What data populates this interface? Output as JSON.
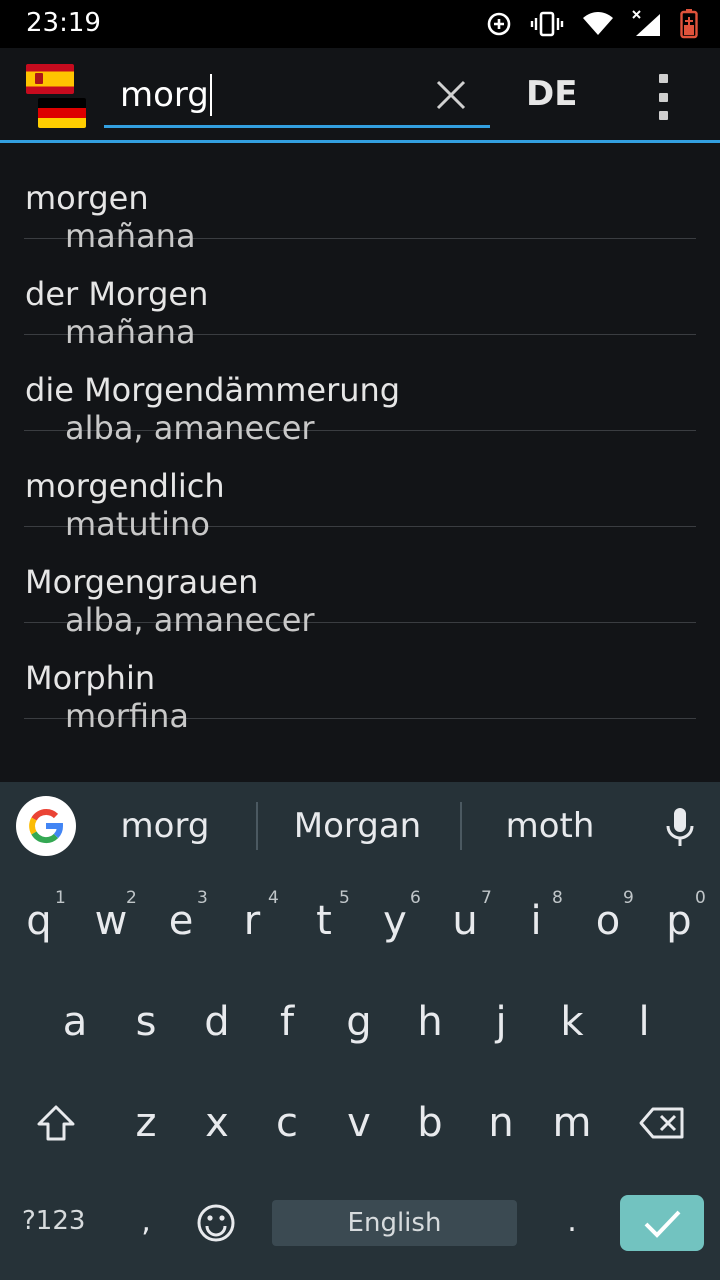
{
  "status_bar": {
    "time": "23:19"
  },
  "search": {
    "query": "morg"
  },
  "language_toggle": "DE",
  "results": [
    {
      "term": "morgen",
      "translation": "mañana"
    },
    {
      "term": "der Morgen",
      "translation": "mañana"
    },
    {
      "term": "die Morgendämmerung",
      "translation": "alba, amanecer"
    },
    {
      "term": "morgendlich",
      "translation": "matutino"
    },
    {
      "term": "Morgengrauen",
      "translation": "alba, amanecer"
    },
    {
      "term": "Morphin",
      "translation": "morfina"
    }
  ],
  "suggestions": [
    "morg",
    "Morgan",
    "moth"
  ],
  "keyboard": {
    "row1": [
      "q",
      "w",
      "e",
      "r",
      "t",
      "y",
      "u",
      "i",
      "o",
      "p"
    ],
    "row1_hints": [
      "1",
      "2",
      "3",
      "4",
      "5",
      "6",
      "7",
      "8",
      "9",
      "0"
    ],
    "row2": [
      "a",
      "s",
      "d",
      "f",
      "g",
      "h",
      "j",
      "k",
      "l"
    ],
    "row3": [
      "z",
      "x",
      "c",
      "v",
      "b",
      "n",
      "m"
    ],
    "symbols_label": "?123",
    "comma": ",",
    "period": ".",
    "space_label": "English"
  },
  "colors": {
    "accent": "#33a0e0",
    "enter_key": "#72c3c0",
    "keyboard_bg": "#263238",
    "list_bg": "#121417"
  }
}
